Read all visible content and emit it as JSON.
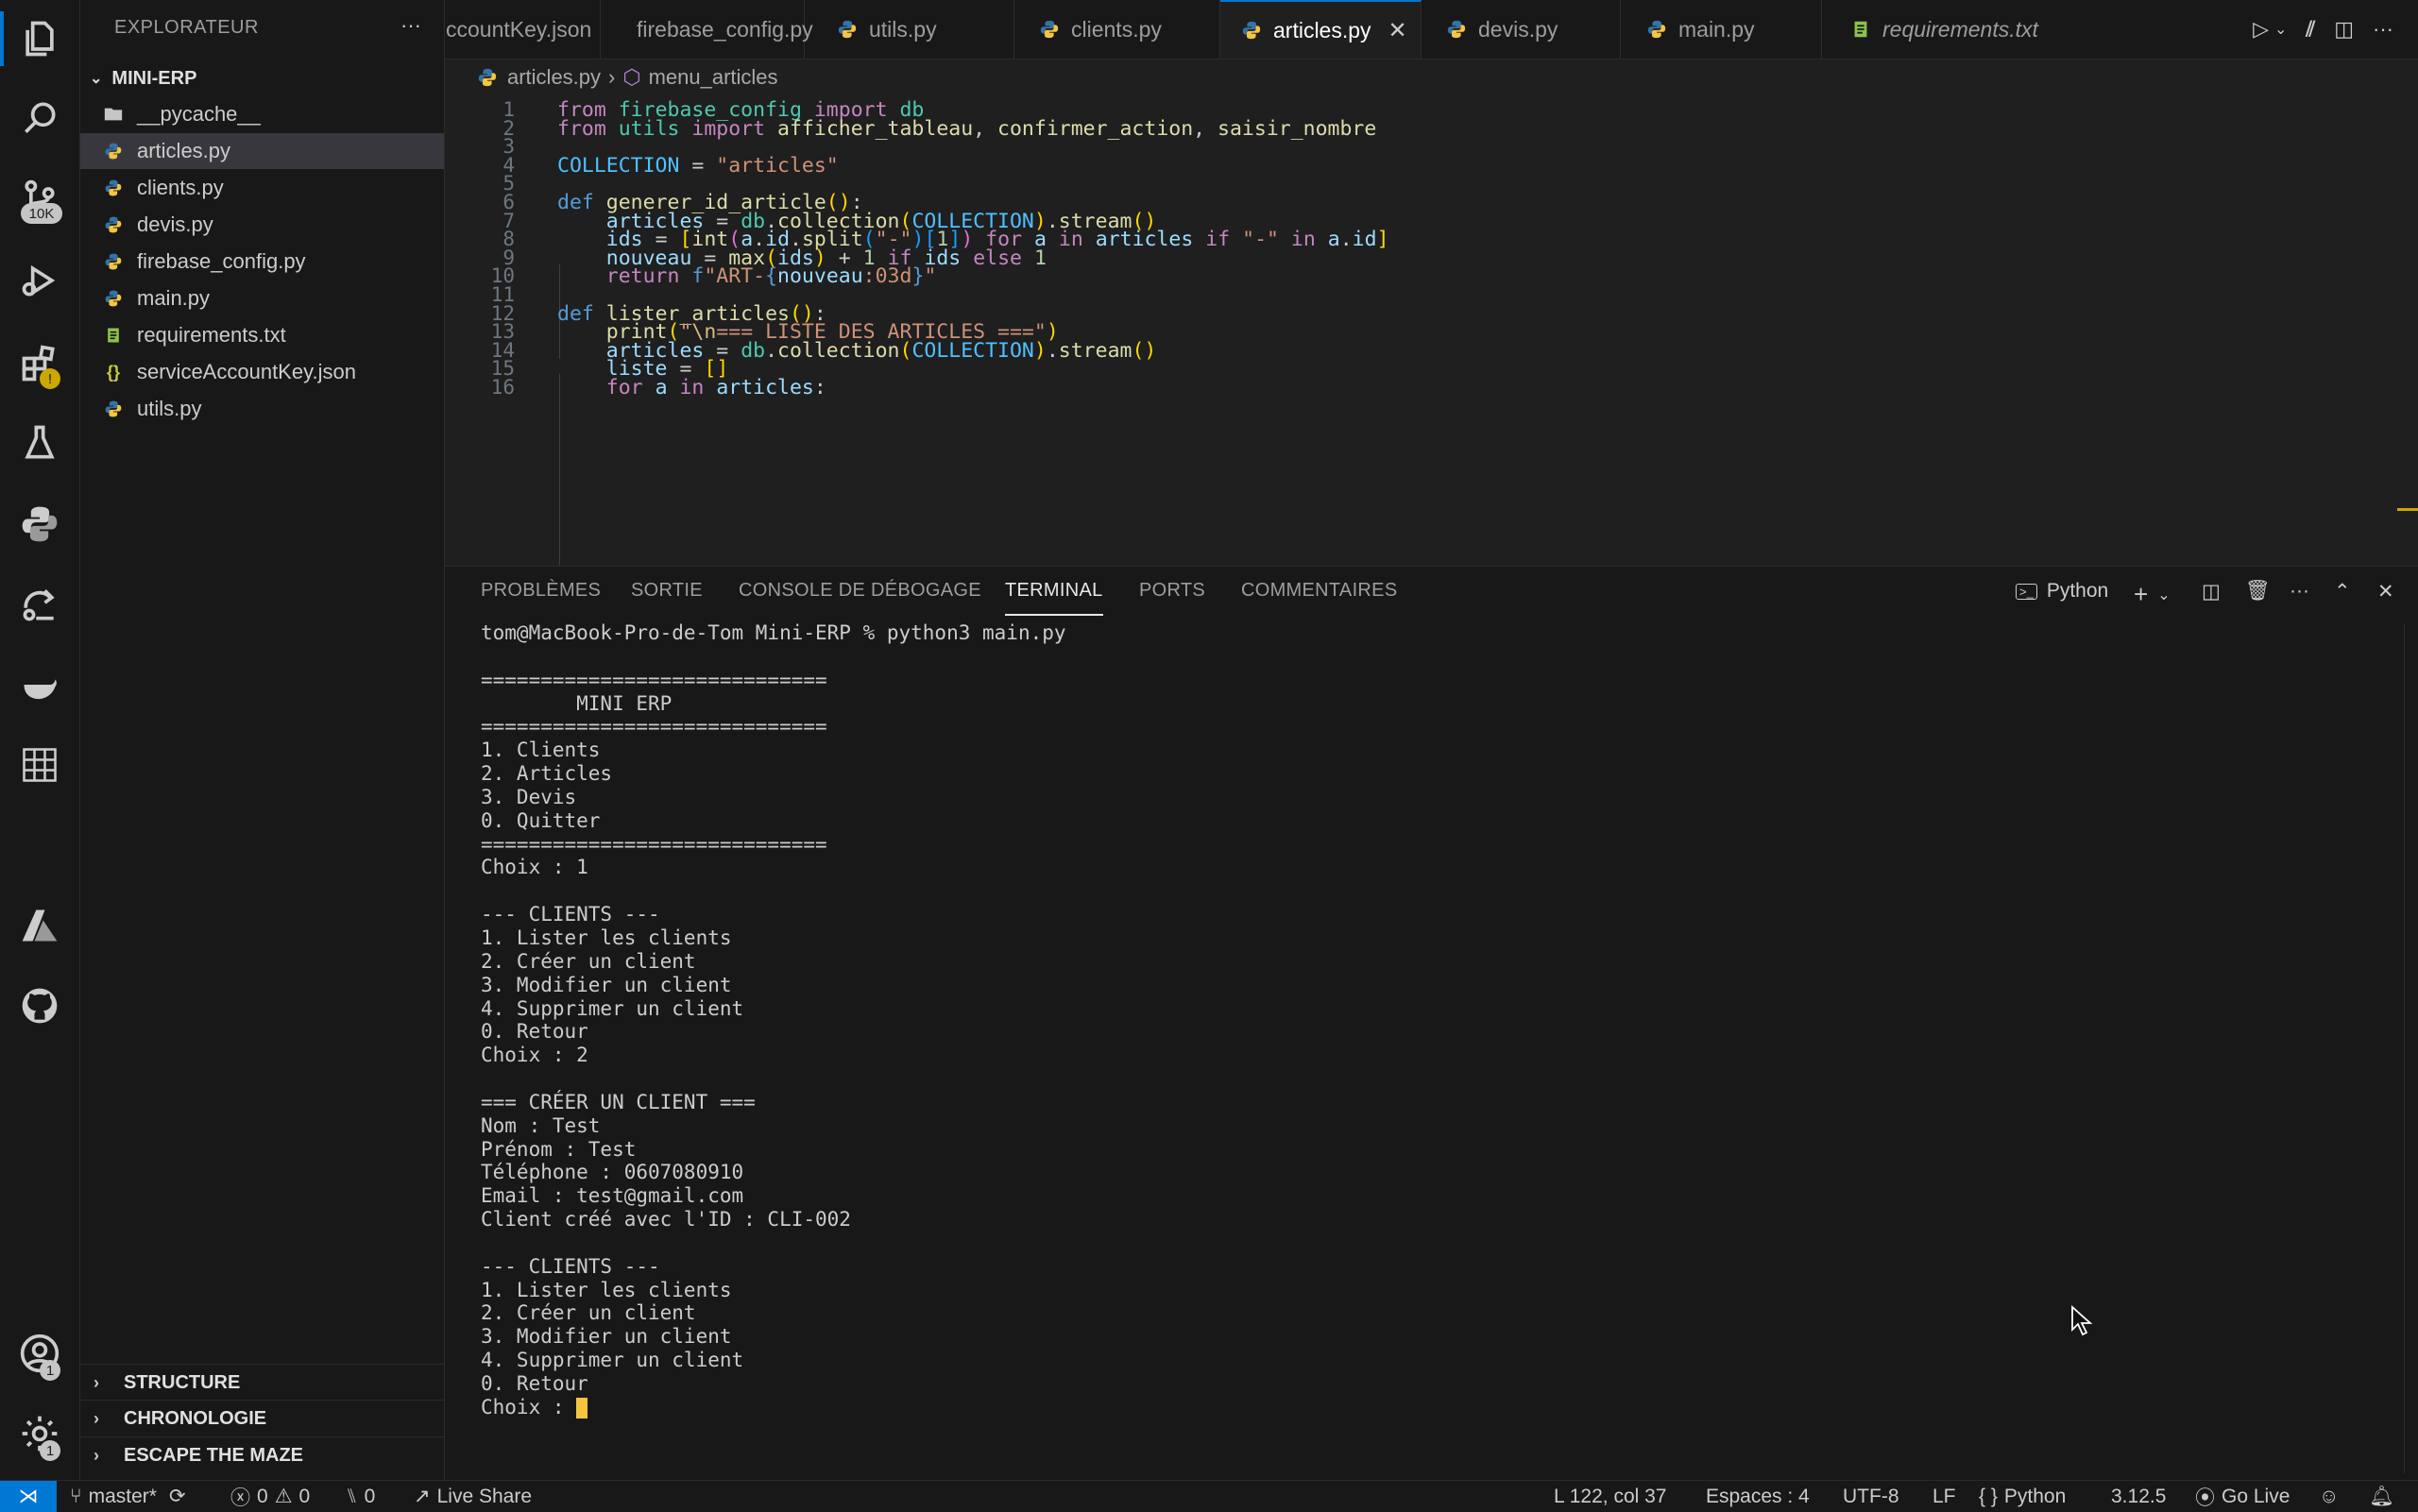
{
  "sidebar": {
    "title": "EXPLORATEUR",
    "folder": "MINI-ERP",
    "files": [
      {
        "name": "__pycache__",
        "type": "folder"
      },
      {
        "name": "articles.py",
        "type": "py"
      },
      {
        "name": "clients.py",
        "type": "py"
      },
      {
        "name": "devis.py",
        "type": "py"
      },
      {
        "name": "firebase_config.py",
        "type": "py"
      },
      {
        "name": "main.py",
        "type": "py"
      },
      {
        "name": "requirements.txt",
        "type": "txt"
      },
      {
        "name": "serviceAccountKey.json",
        "type": "json"
      },
      {
        "name": "utils.py",
        "type": "py"
      }
    ],
    "sections": [
      "STRUCTURE",
      "CHRONOLOGIE",
      "ESCAPE THE MAZE"
    ]
  },
  "activity": {
    "scm_badge": "10K",
    "accounts_badge": "1",
    "manage_badge": "1"
  },
  "tabs": [
    {
      "label": "ccountKey.json"
    },
    {
      "label": "firebase_config.py"
    },
    {
      "label": "utils.py"
    },
    {
      "label": "clients.py"
    },
    {
      "label": "articles.py"
    },
    {
      "label": "devis.py"
    },
    {
      "label": "main.py"
    },
    {
      "label": "requirements.txt"
    }
  ],
  "breadcrumb": {
    "file": "articles.py",
    "symbol": "menu_articles"
  },
  "editor": {
    "line_numbers": [
      "1",
      "2",
      "3",
      "4",
      "5",
      "6",
      "7",
      "8",
      "9",
      "10",
      "11",
      "12",
      "13",
      "14",
      "15",
      "16"
    ],
    "lines": [
      "from firebase_config import db",
      "from utils import afficher_tableau, confirmer_action, saisir_nombre",
      "",
      "COLLECTION = \"articles\"",
      "",
      "def generer_id_article():",
      "    articles = db.collection(COLLECTION).stream()",
      "    ids = [int(a.id.split(\"-\")[1]) for a in articles if \"-\" in a.id]",
      "    nouveau = max(ids) + 1 if ids else 1",
      "    return f\"ART-{nouveau:03d}\"",
      "",
      "def lister_articles():",
      "    print(\"\\n=== LISTE DES ARTICLES ===\")",
      "    articles = db.collection(COLLECTION).stream()",
      "    liste = []",
      "    for a in articles:"
    ]
  },
  "panel": {
    "tabs": [
      "PROBLÈMES",
      "SORTIE",
      "CONSOLE DE DÉBOGAGE",
      "TERMINAL",
      "PORTS",
      "COMMENTAIRES"
    ],
    "shell_label": "Python"
  },
  "terminal": {
    "lines": [
      "tom@MacBook-Pro-de-Tom Mini-ERP % python3 main.py",
      "",
      "=============================",
      "        MINI ERP",
      "=============================",
      "1. Clients",
      "2. Articles",
      "3. Devis",
      "0. Quitter",
      "=============================",
      "Choix : 1",
      "",
      "--- CLIENTS ---",
      "1. Lister les clients",
      "2. Créer un client",
      "3. Modifier un client",
      "4. Supprimer un client",
      "0. Retour",
      "Choix : 2",
      "",
      "=== CRÉER UN CLIENT ===",
      "Nom : Test",
      "Prénom : Test",
      "Téléphone : 0607080910",
      "Email : test@gmail.com",
      "Client créé avec l'ID : CLI-002",
      "",
      "--- CLIENTS ---",
      "1. Lister les clients",
      "2. Créer un client",
      "3. Modifier un client",
      "4. Supprimer un client",
      "0. Retour",
      "Choix : "
    ]
  },
  "status": {
    "branch": "master*",
    "errors": "0",
    "warnings": "0",
    "ports": "0",
    "live_share": "Live Share",
    "position": "L 122, col 37",
    "spaces": "Espaces : 4",
    "encoding": "UTF-8",
    "eol": "LF",
    "language": "Python",
    "version": "3.12.5",
    "go_live": "Go Live"
  },
  "colors": {
    "accent": "#0078d4",
    "python_blue": "#3572A5",
    "python_yellow": "#f5c542",
    "txt_green": "#8bc34a",
    "json_yellow": "#cbcb41"
  }
}
